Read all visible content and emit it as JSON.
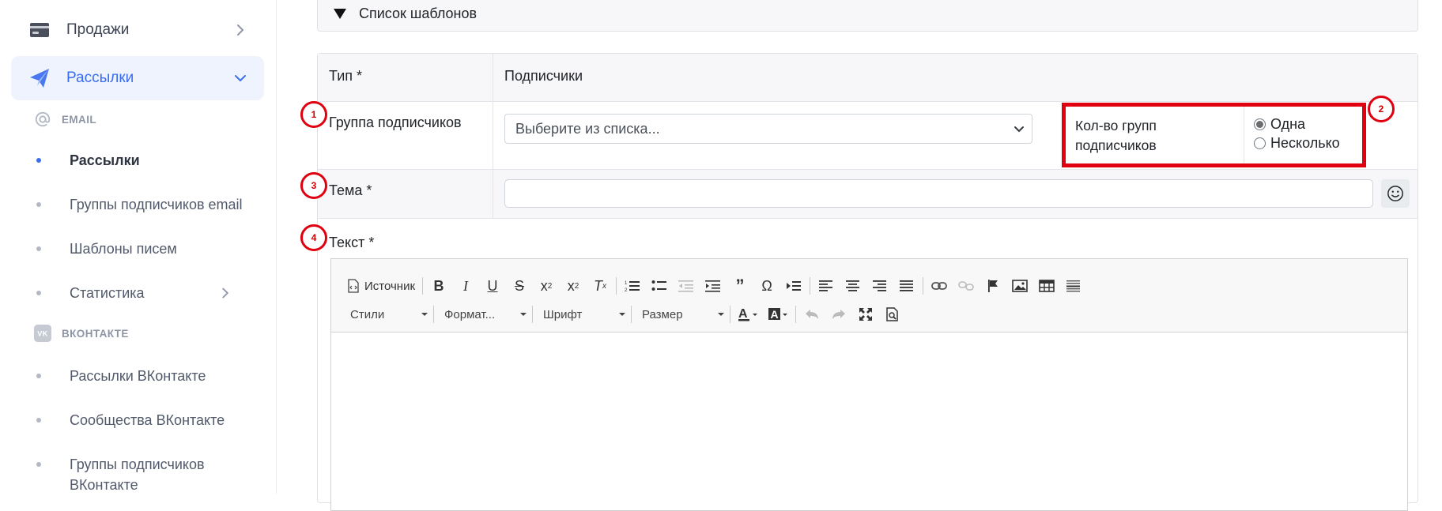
{
  "sidebar": {
    "top_items": [
      {
        "label": "Продажи",
        "icon": "card-icon"
      },
      {
        "label": "Рассылки",
        "icon": "paper-plane-icon",
        "active": true
      }
    ],
    "email_section": "EMAIL",
    "email_items": [
      {
        "label": "Рассылки",
        "active": true
      },
      {
        "label": "Группы подписчиков email"
      },
      {
        "label": "Шаблоны писем"
      },
      {
        "label": "Статистика"
      }
    ],
    "vk_section": "ВКОНТАКТЕ",
    "vk_items": [
      {
        "label": "Рассылки ВКонтакте"
      },
      {
        "label": "Сообщества ВКонтакте"
      },
      {
        "label": "Группы подписчиков ВКонтакте"
      }
    ]
  },
  "templates_panel": {
    "label": "Список шаблонов"
  },
  "form": {
    "type_label": "Тип *",
    "type_value": "Подписчики",
    "group_label": "Группа подписчиков",
    "group_select_value": "Выберите из списка...",
    "count_label": "Кол-во групп подписчиков",
    "count_options": [
      {
        "label": "Одна",
        "selected": true
      },
      {
        "label": "Несколько",
        "selected": false
      }
    ],
    "subject_label": "Тема *",
    "subject_value": "",
    "text_label": "Текст *"
  },
  "badges": [
    "1",
    "2",
    "3",
    "4"
  ],
  "editor": {
    "source_label": "Источник",
    "combos": [
      "Стили",
      "Формат...",
      "Шрифт",
      "Размер"
    ]
  },
  "colors": {
    "accent": "#3a6df0",
    "highlight": "#e0000f"
  }
}
